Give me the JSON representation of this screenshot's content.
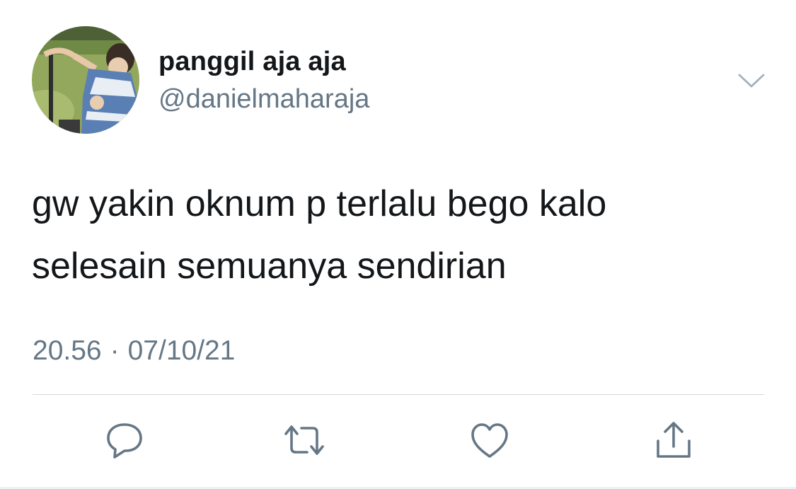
{
  "tweet": {
    "author": {
      "display_name": "panggil aja aja",
      "handle": "@danielmaharaja",
      "avatar_icon": "profile-photo"
    },
    "menu_icon": "chevron-down-icon",
    "text_line_1": "gw yakin oknum p terlalu bego kalo",
    "text_line_2": "selesain semuanya sendirian",
    "time": "20.56",
    "separator": "·",
    "date": "07/10/21"
  },
  "actions": [
    {
      "icon": "reply-icon"
    },
    {
      "icon": "retweet-icon"
    },
    {
      "icon": "like-icon"
    },
    {
      "icon": "share-icon"
    }
  ],
  "colors": {
    "primary_text": "#14171a",
    "secondary_text": "#657786",
    "icon_gray": "#657786",
    "divider": "#d4dadf"
  }
}
